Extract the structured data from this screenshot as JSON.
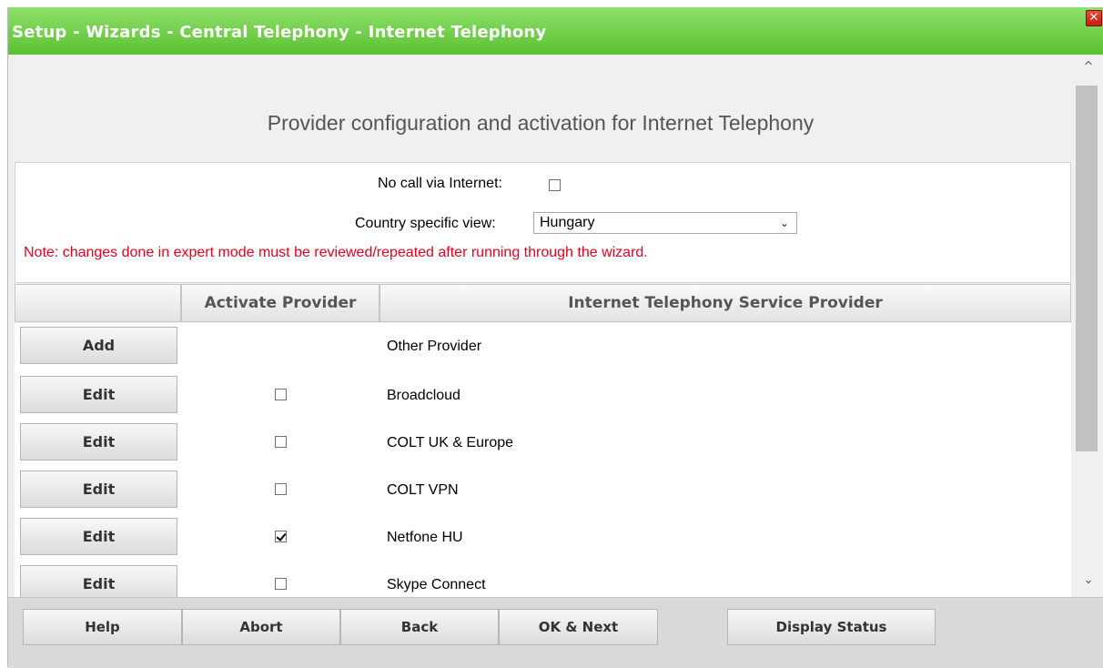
{
  "window": {
    "title": "Setup - Wizards - Central Telephony - Internet Telephony",
    "close_glyph": "✕"
  },
  "heading": "Provider configuration and activation for Internet Telephony",
  "options": {
    "no_call_label": "No call via Internet:",
    "no_call_checked": false,
    "country_label": "Country specific view:",
    "country_value": "Hungary",
    "note": "Note: changes done in expert mode must be reviewed/repeated after running through the wizard."
  },
  "table": {
    "headers": [
      "",
      "Activate Provider",
      "Internet Telephony Service Provider"
    ],
    "rows": [
      {
        "button": "Add",
        "has_checkbox": false,
        "checked": false,
        "provider": "Other Provider"
      },
      {
        "button": "Edit",
        "has_checkbox": true,
        "checked": false,
        "provider": "Broadcloud"
      },
      {
        "button": "Edit",
        "has_checkbox": true,
        "checked": false,
        "provider": "COLT UK & Europe"
      },
      {
        "button": "Edit",
        "has_checkbox": true,
        "checked": false,
        "provider": "COLT VPN"
      },
      {
        "button": "Edit",
        "has_checkbox": true,
        "checked": true,
        "provider": "Netfone HU"
      },
      {
        "button": "Edit",
        "has_checkbox": true,
        "checked": false,
        "provider": "Skype Connect"
      }
    ]
  },
  "footer": {
    "help": "Help",
    "abort": "Abort",
    "back": "Back",
    "ok_next": "OK & Next",
    "display_status": "Display Status"
  },
  "icons": {
    "chevron_up": "^",
    "chevron_down": "⌄",
    "select_chevron": "⌄"
  },
  "colors": {
    "titlebar": "#5cc132",
    "note": "#e8001c",
    "close": "#d42010"
  }
}
